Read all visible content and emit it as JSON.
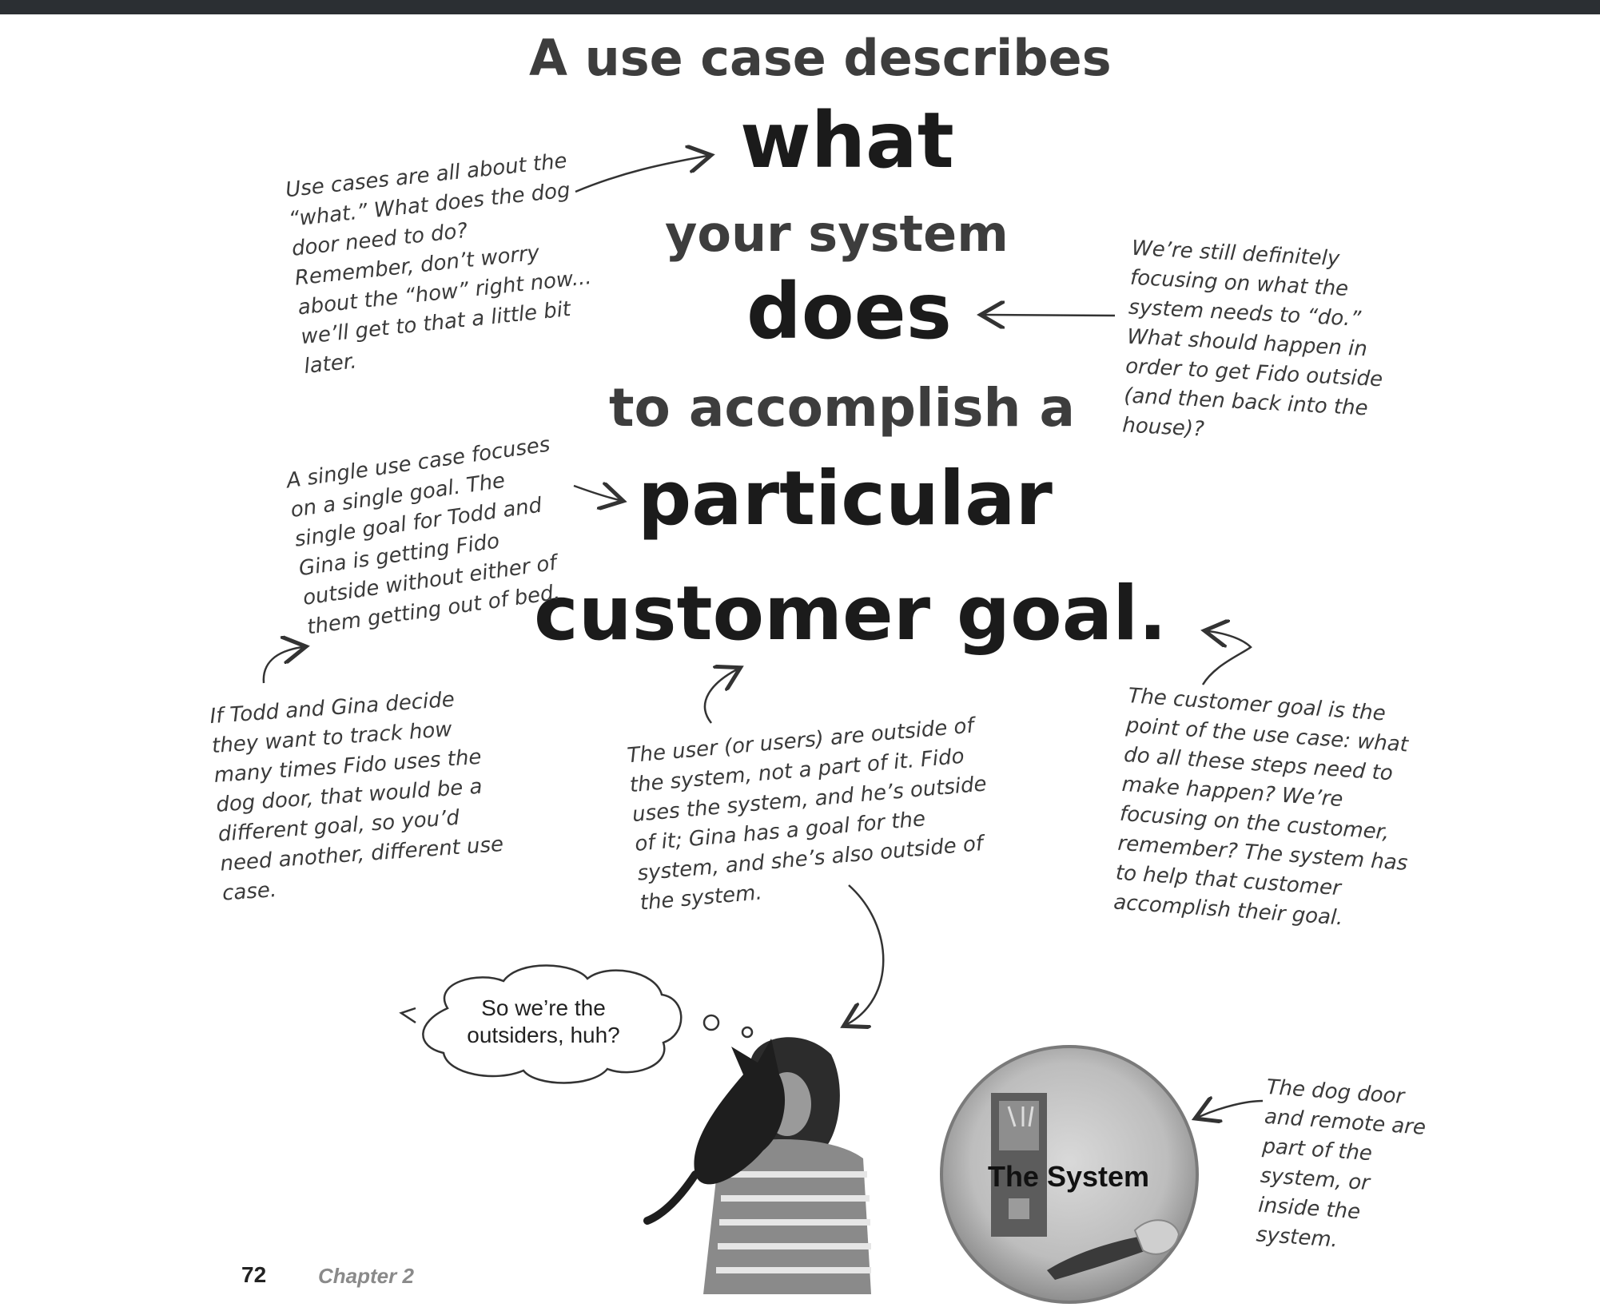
{
  "headline": {
    "line1": "A use case describes",
    "line2": "what",
    "line3": "your system",
    "line4": "does",
    "line5": "to accomplish a",
    "line6": "particular",
    "line7": "customer goal."
  },
  "notes": {
    "top_left": "Use cases are all about the “what.” What does the dog door need to do? Remember, don’t worry about the “how” right now... we’ll get to that a little bit later.",
    "right": "We’re still definitely focusing on what the system needs to “do.” What should happen in order to get Fido outside (and then back into the house)?",
    "middle_left": "A single use case focuses on a single goal. The single goal for Todd and Gina is getting Fido outside without either of them getting out of bed.",
    "bottom_left": "If Todd and Gina decide they want to track how many times Fido uses the dog door, that would be a different goal, so you’d need another, different use case.",
    "bottom_center": "The user (or users) are outside of the system, not a part of it. Fido uses the system, and he’s outside of it; Gina has a goal for the system, and she’s also outside of the system.",
    "bottom_right": "The customer goal is the point of the use case: what do all these steps need to make happen? We’re focusing on the customer, remember? The system has to help that customer accomplish their goal.",
    "system_note": "The dog door and remote are part of the system, or inside the system."
  },
  "bubble": {
    "text": "So we’re the outsiders, huh?"
  },
  "system": {
    "label": "The System"
  },
  "footer": {
    "page_number": "72",
    "chapter": "Chapter 2"
  }
}
